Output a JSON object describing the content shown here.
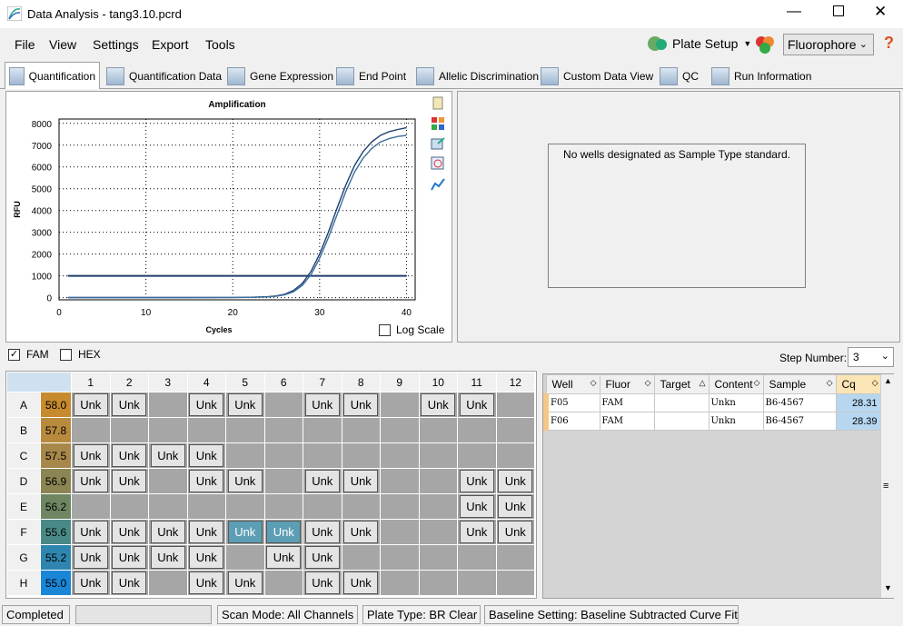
{
  "window": {
    "title": "Data Analysis - tang3.10.pcrd"
  },
  "menu": [
    {
      "label": "File"
    },
    {
      "label": "View"
    },
    {
      "label": "Settings"
    },
    {
      "label": "Export"
    },
    {
      "label": "Tools"
    }
  ],
  "toolbar": {
    "plate_setup": "Plate Setup",
    "fluorophore": "Fluorophore"
  },
  "tabs": [
    {
      "label": "Quantification",
      "icon": "amplification-icon"
    },
    {
      "label": "Quantification Data",
      "icon": "data-sheet-icon"
    },
    {
      "label": "Gene Expression",
      "icon": "bar-chart-icon"
    },
    {
      "label": "End Point",
      "icon": "end-point-icon"
    },
    {
      "label": "Allelic Discrimination",
      "icon": "allelic-icon"
    },
    {
      "label": "Custom Data View",
      "icon": "gear-icon"
    },
    {
      "label": "QC",
      "icon": "qc-check-icon"
    },
    {
      "label": "Run Information",
      "icon": "run-info-icon"
    }
  ],
  "chart_data": {
    "type": "line",
    "title": "Amplification",
    "xlabel": "Cycles",
    "ylabel": "RFU",
    "xlim": [
      0,
      41
    ],
    "ylim": [
      -100,
      8200
    ],
    "xticks": [
      0,
      10,
      20,
      30,
      40
    ],
    "yticks": [
      0,
      1000,
      2000,
      3000,
      4000,
      5000,
      6000,
      7000,
      8000
    ],
    "grid": "dotted",
    "threshold": 1000,
    "series": [
      {
        "well": "F05",
        "color": "#1f3f6e",
        "x": [
          1,
          5,
          10,
          15,
          20,
          22,
          24,
          25,
          26,
          27,
          28,
          29,
          30,
          31,
          32,
          33,
          34,
          35,
          36,
          37,
          38,
          39,
          40
        ],
        "y": [
          5,
          5,
          5,
          5,
          8,
          15,
          40,
          80,
          160,
          330,
          650,
          1200,
          2000,
          3000,
          4100,
          5150,
          6050,
          6700,
          7150,
          7450,
          7620,
          7720,
          7800
        ]
      },
      {
        "well": "F06",
        "color": "#3a6f9e",
        "x": [
          1,
          5,
          10,
          15,
          20,
          22,
          24,
          25,
          26,
          27,
          28,
          29,
          30,
          31,
          32,
          33,
          34,
          35,
          36,
          37,
          38,
          39,
          40
        ],
        "y": [
          5,
          5,
          5,
          5,
          7,
          12,
          33,
          65,
          130,
          270,
          560,
          1050,
          1800,
          2750,
          3800,
          4850,
          5750,
          6400,
          6850,
          7150,
          7300,
          7400,
          7450
        ]
      }
    ]
  },
  "log_scale_label": "Log Scale",
  "std_message": "No wells designated as Sample Type standard.",
  "fluor_checks": [
    {
      "label": "FAM",
      "checked": true
    },
    {
      "label": "HEX",
      "checked": false
    }
  ],
  "step": {
    "label": "Step Number:",
    "value": "3"
  },
  "plate": {
    "columns": [
      "1",
      "2",
      "3",
      "4",
      "5",
      "6",
      "7",
      "8",
      "9",
      "10",
      "11",
      "12"
    ],
    "rows": [
      {
        "row": "A",
        "temp": "58.0",
        "color": "#c88a2e",
        "wells": [
          1,
          1,
          0,
          1,
          1,
          0,
          1,
          1,
          0,
          1,
          1,
          0
        ]
      },
      {
        "row": "B",
        "temp": "57.8",
        "color": "#b88a3e",
        "wells": [
          0,
          0,
          0,
          0,
          0,
          0,
          0,
          0,
          0,
          0,
          0,
          0
        ]
      },
      {
        "row": "C",
        "temp": "57.5",
        "color": "#a8884a",
        "wells": [
          1,
          1,
          1,
          1,
          0,
          0,
          0,
          0,
          0,
          0,
          0,
          0
        ]
      },
      {
        "row": "D",
        "temp": "56.9",
        "color": "#8a8552",
        "wells": [
          1,
          1,
          0,
          1,
          1,
          0,
          1,
          1,
          0,
          0,
          1,
          1
        ]
      },
      {
        "row": "E",
        "temp": "56.2",
        "color": "#6e8662",
        "wells": [
          0,
          0,
          0,
          0,
          0,
          0,
          0,
          0,
          0,
          0,
          1,
          1
        ]
      },
      {
        "row": "F",
        "temp": "55.6",
        "color": "#4a8a86",
        "wells": [
          1,
          1,
          1,
          1,
          2,
          2,
          1,
          1,
          0,
          0,
          1,
          1
        ]
      },
      {
        "row": "G",
        "temp": "55.2",
        "color": "#2e86b0",
        "wells": [
          1,
          1,
          1,
          1,
          0,
          1,
          1,
          0,
          0,
          0,
          0,
          0
        ]
      },
      {
        "row": "H",
        "temp": "55.0",
        "color": "#1a86d6",
        "wells": [
          1,
          1,
          0,
          1,
          1,
          0,
          1,
          1,
          0,
          0,
          0,
          0
        ]
      }
    ],
    "well_label": "Unk"
  },
  "table": {
    "headers": [
      "Well",
      "Fluor",
      "Target",
      "Content",
      "Sample",
      "Cq"
    ],
    "rows": [
      [
        "F05",
        "FAM",
        "",
        "Unkn",
        "B6-4567",
        "28.31"
      ],
      [
        "F06",
        "FAM",
        "",
        "Unkn",
        "B6-4567",
        "28.39"
      ]
    ]
  },
  "status": {
    "state": "Completed",
    "scan_mode": "Scan Mode: All Channels",
    "plate_type": "Plate Type: BR Clear",
    "baseline": "Baseline Setting: Baseline Subtracted Curve Fit"
  }
}
